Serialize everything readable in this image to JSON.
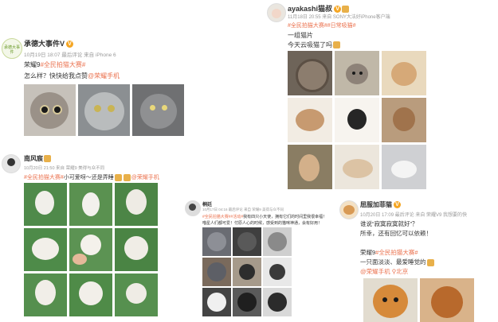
{
  "post_top_right": {
    "username": "ayakashi猫叔",
    "meta": "11月18日 20:55 来自 SONY大法好iPhone客户端",
    "tags": "#全民拍猫大赛##日常吸猫#",
    "line1": "一组猫片",
    "line2": "今天云吸猫了吗",
    "colors": {
      "bg1": "#7a6f62",
      "bg2": "#c9b89d",
      "bg3": "#e8d6b8",
      "bg4": "#a7b0ae",
      "bg5": "#f4efe8",
      "bg6": "#b59271",
      "bg7": "#8a7f63",
      "bg8": "#e9e4dc",
      "bg9": "#c7c7c9"
    }
  },
  "post_top_left": {
    "avatar_text": "承德大事件",
    "username": "承德大事件V",
    "meta": "10月19日 18:07 最后评论 来自 iPhone 6",
    "line1_prefix": "荣耀9",
    "line1_tag": "#全民拍猫大赛#",
    "line2_prefix": "怎么样？快快给我点赞",
    "line2_mention": "@荣耀手机"
  },
  "post_mid_left": {
    "username": "南风宸",
    "meta": "10月20日 21:50 来自 荣耀9 美得与众不同",
    "tag": "#全民拍猫大赛#",
    "line": "小可爱呀～还是弄睡",
    "mention": "@荣耀手机"
  },
  "post_bottom_mid": {
    "username": "桐廷",
    "meta": "10月17日 04:16 最后评论 来自 荣耀9 美得与众不同",
    "tags": "#全民拍猫大赛##活动#",
    "line1": "我有四只小天使，拥有它们的时间里我很幸福！",
    "line2": "喵星人们都可爱！付原人心的时候，感受到的猫咪神通，会有好用！"
  },
  "post_bottom_right": {
    "username": "屈服加菲猫",
    "meta": "10月20日 17:09 最后评论 来自 荣耀V9 我想要的快",
    "line1": "谁说“寂寞寂寞就好”？",
    "line2": "所幸，还有回忆可以依赖！",
    "line3_prefix": "荣耀9",
    "line3_tag": "#全民拍猫大赛#",
    "line4": "一只面淡淡、最爱睡觉的",
    "mention": "@荣耀手机",
    "location": "北京"
  }
}
